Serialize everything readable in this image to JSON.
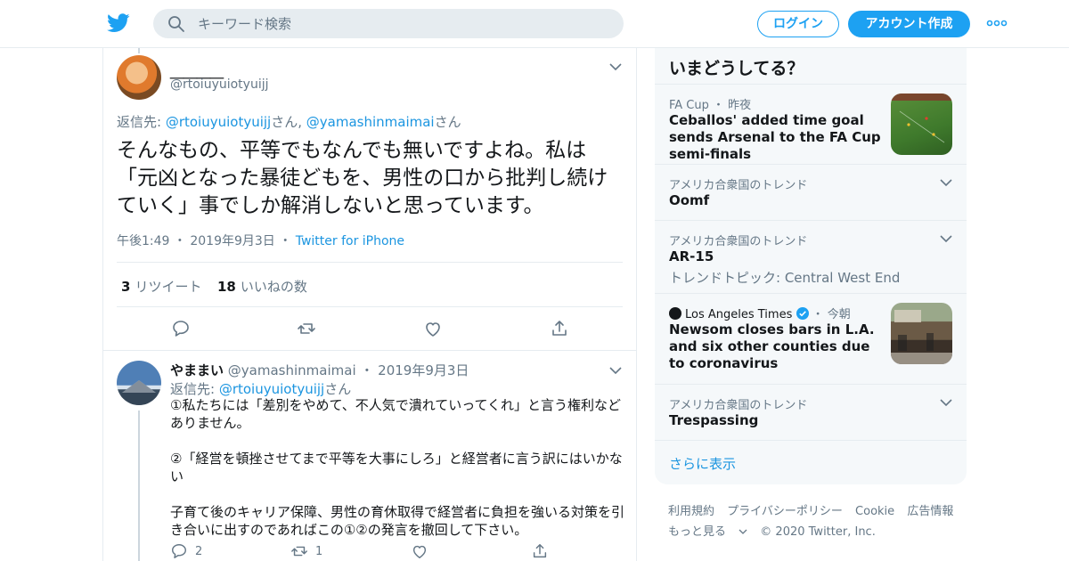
{
  "header": {
    "search_placeholder": "キーワード検索",
    "login_label": "ログイン",
    "signup_label": "アカウント作成",
    "brand_color": "#1da1f2"
  },
  "main_tweet": {
    "display_name": "＿＿＿＿",
    "handle": "@rtoiuyuiotyuijj",
    "reply_prefix": "返信先: ",
    "reply_user1": "@rtoiuyuiotyuijj",
    "reply_san1": "さん, ",
    "reply_user2": "@yamashinmaimai",
    "reply_san2": "さん",
    "text": "そんなもの、平等でもなんでも無いですよね。私は「元凶となった暴徒どもを、男性の口から批判し続けていく」事でしか解消しないと思っています。",
    "time": "午後1:49",
    "date": "2019年9月3日",
    "source": "Twitter for iPhone",
    "retweet_count": "3",
    "retweet_label": "リツイート",
    "like_count": "18",
    "like_label": "いいねの数"
  },
  "reply_tweet": {
    "display_name": "やままい",
    "handle": "@yamashinmaimai",
    "date": "2019年9月3日",
    "reply_prefix": "返信先: ",
    "reply_user": "@rtoiuyuiotyuijj",
    "reply_san": "さん",
    "paragraph1": "①私たちには「差別をやめて、不人気で潰れていってくれ」と言う権利などありません。",
    "paragraph2": "②「経営を頓挫させてまで平等を大事にしろ」と経営者に言う訳にはいかない",
    "paragraph3": "子育て後のキャリア保障、男性の育休取得で経営者に負担を強いる対策を引き合いに出すのであればこの①②の発言を撤回して下さい。",
    "reply_count": "2",
    "retweet_count": "1"
  },
  "trends": {
    "title": "いまどうしてる？",
    "items": [
      {
        "category": "FA Cup ・ 昨夜",
        "headline": "Ceballos' added time goal sends Arsenal to the FA Cup semi-finals"
      },
      {
        "category": "アメリカ合衆国のトレンド",
        "headline": "Oomf"
      },
      {
        "category": "アメリカ合衆国のトレンド",
        "headline": "AR-15",
        "subline": "トレンドトピック: Central West End"
      },
      {
        "source": "Los Angeles Times",
        "time": " ・ 今朝",
        "headline": "Newsom closes bars in L.A. and six other counties due to coronavirus"
      },
      {
        "category": "アメリカ合衆国のトレンド",
        "headline": "Trespassing"
      }
    ],
    "show_more": "さらに表示"
  },
  "footer": {
    "terms": "利用規約",
    "privacy": "プライバシーポリシー",
    "cookie": "Cookie",
    "ads": "広告情報",
    "more": "もっと見る",
    "copyright": "© 2020 Twitter, Inc."
  }
}
